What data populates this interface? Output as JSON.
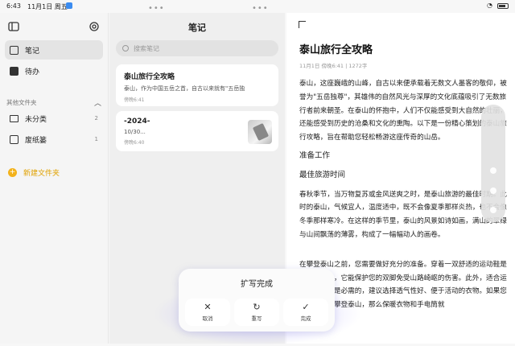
{
  "status_bar": {
    "time": "6:43",
    "date": "11月1日 周五"
  },
  "sidebar": {
    "items": [
      {
        "label": "笔记",
        "count": ""
      },
      {
        "label": "待办",
        "count": ""
      }
    ],
    "section_title": "其他文件夹",
    "folders": [
      {
        "label": "未分类",
        "count": "2"
      },
      {
        "label": "废纸篓",
        "count": "1"
      }
    ],
    "new_folder": "新建文件夹",
    "icons": {
      "sidebar_toggle": "sidebar-toggle-icon",
      "settings": "gear-icon"
    }
  },
  "list": {
    "title": "笔记",
    "search_placeholder": "搜索笔记",
    "notes": [
      {
        "title": "泰山旅行全攻略",
        "preview": "泰山，作为中国五岳之首，自古以来就有\"五岳独",
        "meta": "傍晚6:41"
      },
      {
        "title": "-2024-",
        "preview": "10/30...",
        "meta": "傍晚6:40"
      }
    ]
  },
  "editor": {
    "title": "泰山旅行全攻略",
    "meta": "11月1日 傍晚6:41  |  1272字",
    "paragraphs": [
      "泰山，这座巍峨的山峰，自古以来便承载着无数文人墨客的敬仰，被誉为\"五岳独尊\"，其雄伟的自然风光与深厚的文化底蕴吸引了无数旅行者前来朝圣。在泰山的怀抱中，人们不仅能感受到大自然的壮丽，还能感受到历史的沧桑和文化的熏陶。以下是一份精心策划的泰山旅行攻略，旨在帮助您轻松畅游这座传奇的山岳。",
      "准备工作",
      "最佳旅游时间",
      "春秋季节，当万物复苏或金风送爽之时，是泰山旅游的最佳时期。此时的泰山，气候宜人，温度适中，既不会像夏季那样炎热，也不会像冬季那样寒冷。在这样的季节里，泰山的风景如诗如画，满山的翠绿与山间飘荡的薄雾，构成了一幅幅动人的画卷。",
      "在攀登泰山之前，您需要做好充分的准备。穿着一双舒适的运动鞋是必不可少的，它能保护您的双脚免受山路崎岖的伤害。此外，适合运动的服装也是必需的，建议选择透气性好、便于活动的衣物。如果您计划在夜晚攀登泰山，那么保暖衣物和手电筒就"
    ]
  },
  "dialog": {
    "title": "扩写完成",
    "buttons": [
      {
        "label": "取消",
        "icon": "close-icon",
        "glyph": "✕"
      },
      {
        "label": "重写",
        "icon": "refresh-icon",
        "glyph": "↻"
      },
      {
        "label": "完成",
        "icon": "check-icon",
        "glyph": "✓"
      }
    ]
  },
  "colors": {
    "accent": "#f3b21b",
    "background": "#f7f7f7"
  }
}
